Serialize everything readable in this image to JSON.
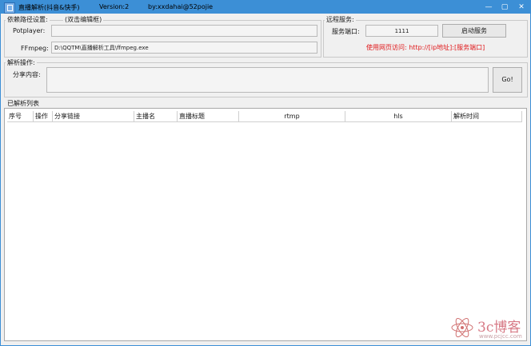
{
  "titlebar": {
    "app_name": "直播解析(抖音&快手)",
    "version": "Version:2",
    "author": "by:xxdahai@52pojie",
    "minimize": "—",
    "maximize": "▢",
    "close": "✕"
  },
  "paths": {
    "group_title": "依赖路径设置:",
    "hint": "(双击编辑框)",
    "potplayer_label": "Potplayer:",
    "potplayer_value": "",
    "ffmpeg_label": "FFmpeg:",
    "ffmpeg_value": "D:\\QQTM\\直播解析工具\\ffmpeg.exe"
  },
  "remote": {
    "group_title": "远程服务:",
    "port_label": "服务端口:",
    "port_value": "1111",
    "start_button": "启动服务",
    "notice": "使用网页访问: http://[ip地址]:[服务端口]"
  },
  "parse": {
    "group_title": "解析操作:",
    "share_label": "分享内容:",
    "share_value": "",
    "go_button": "Go!"
  },
  "list": {
    "group_title": "已解析列表",
    "columns": [
      "序号",
      "操作",
      "分享链接",
      "主播名",
      "直播标题",
      "rtmp",
      "hls",
      "解析时间"
    ],
    "rows": []
  },
  "watermark": {
    "brand": "3c博客",
    "url": "www.pcjcc.com"
  },
  "colors": {
    "titlebar": "#3c8fd6",
    "notice_red": "#e0191b"
  }
}
